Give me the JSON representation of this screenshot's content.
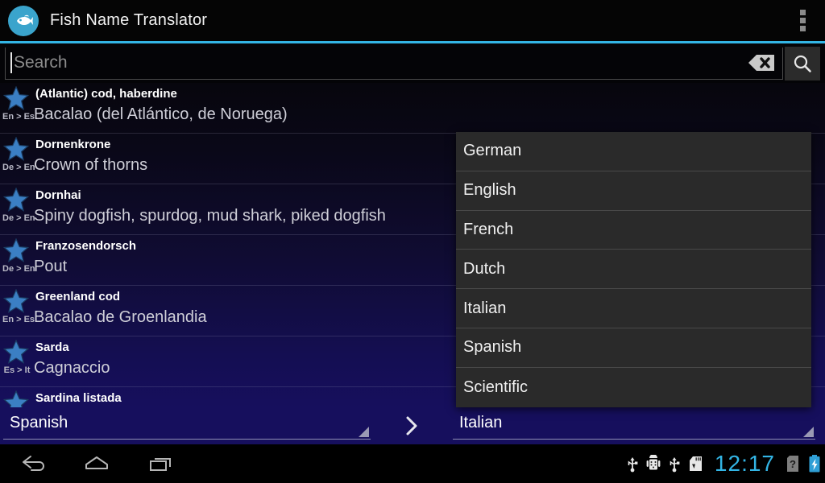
{
  "app": {
    "title": "Fish Name Translator",
    "icon": "fish-icon",
    "accent_color": "#33b5e5",
    "overflow_menu_label": "More options"
  },
  "search": {
    "placeholder": "Search",
    "value": "",
    "clear_icon": "backspace-icon",
    "search_icon": "search-icon"
  },
  "list": {
    "rows": [
      {
        "title": "(Atlantic) cod, haberdine",
        "translation": "Bacalao (del Atlántico, de Noruega)",
        "direction": "En > Es",
        "starred": true
      },
      {
        "title": "Dornenkrone",
        "translation": "Crown of thorns",
        "direction": "De > En",
        "starred": true
      },
      {
        "title": "Dornhai",
        "translation": "Spiny dogfish, spurdog, mud shark, piked dogfish",
        "direction": "De > En",
        "starred": true
      },
      {
        "title": "Franzosendorsch",
        "translation": "Pout",
        "direction": "De > En",
        "starred": true
      },
      {
        "title": "Greenland cod",
        "translation": "Bacalao de Groenlandia",
        "direction": "En > Es",
        "starred": true
      },
      {
        "title": "Sarda",
        "translation": "Cagnaccio",
        "direction": "Es > It",
        "starred": true
      },
      {
        "title": "Sardina listada",
        "translation": "",
        "direction": "",
        "starred": true
      }
    ]
  },
  "language_bar": {
    "from_language": "Spanish",
    "to_language": "Italian",
    "swap_icon": "chevron-right-icon"
  },
  "dropdown": {
    "open": true,
    "options": [
      "German",
      "English",
      "French",
      "Dutch",
      "Italian",
      "Spanish",
      "Scientific"
    ]
  },
  "nav_bar": {
    "back_label": "Back",
    "home_label": "Home",
    "recents_label": "Recent apps",
    "clock": "12:17",
    "status_icons": [
      "usb-icon",
      "android-debug-icon",
      "usb-icon",
      "sd-card-icon",
      "sim-missing-icon",
      "battery-charging-icon"
    ]
  }
}
